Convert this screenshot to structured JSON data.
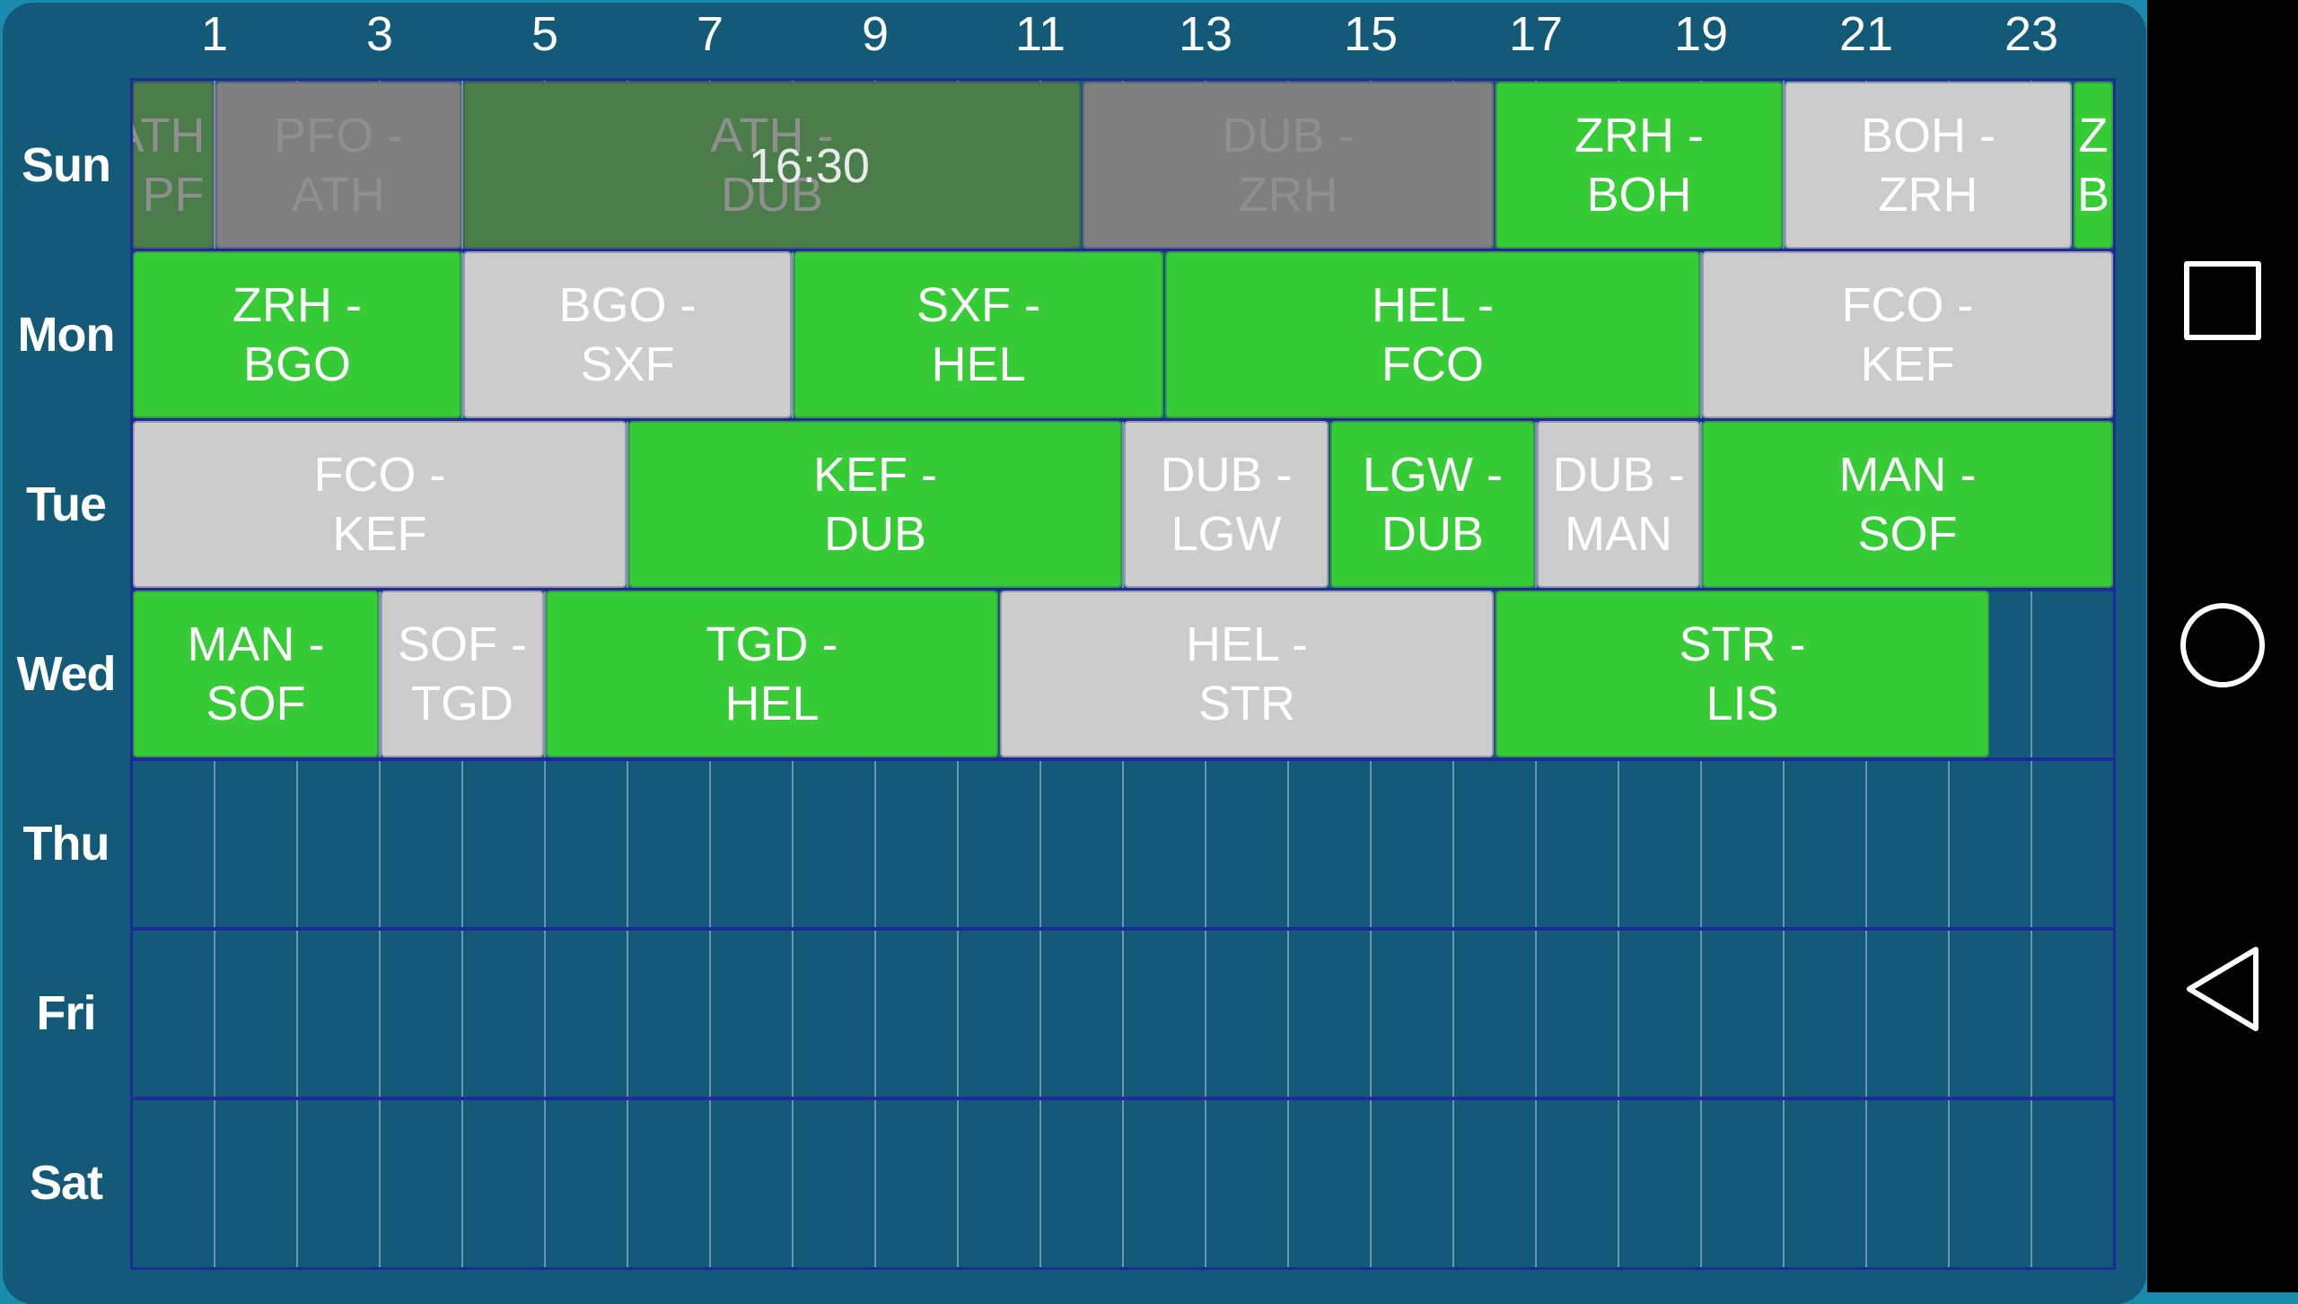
{
  "timetable": {
    "hour_labels": [
      "1",
      "3",
      "5",
      "7",
      "9",
      "11",
      "13",
      "15",
      "17",
      "19",
      "21",
      "23"
    ],
    "hour_label_values": [
      1,
      3,
      5,
      7,
      9,
      11,
      13,
      15,
      17,
      19,
      21,
      23
    ],
    "days": [
      "Sun",
      "Mon",
      "Tue",
      "Wed",
      "Thu",
      "Fri",
      "Sat"
    ],
    "current_time": "16:30",
    "current_time_position": {
      "day": 0,
      "hour": 8.2
    },
    "colors": {
      "active_green": "#36cc36",
      "active_gray": "#cccccc",
      "past_green": "#4a7d4a",
      "past_gray": "#7f7f7f",
      "grid_border": "#1f2a9a",
      "panel_background": "#135a78"
    },
    "flights": [
      {
        "day": 0,
        "start": 0,
        "end": 1,
        "from": "ATH",
        "to": "PFO",
        "line1": "ATH -",
        "line2": "PF",
        "color": "green",
        "past": true
      },
      {
        "day": 0,
        "start": 1,
        "end": 4,
        "from": "PFO",
        "to": "ATH",
        "line1": "PFO -",
        "line2": "ATH",
        "color": "gray",
        "past": true
      },
      {
        "day": 0,
        "start": 4,
        "end": 11.5,
        "from": "ATH",
        "to": "DUB",
        "line1": "ATH -",
        "line2": "DUB",
        "color": "green",
        "past": true
      },
      {
        "day": 0,
        "start": 11.5,
        "end": 16.5,
        "from": "DUB",
        "to": "ZRH",
        "line1": "DUB -",
        "line2": "ZRH",
        "color": "gray",
        "past": true
      },
      {
        "day": 0,
        "start": 16.5,
        "end": 20,
        "from": "ZRH",
        "to": "BOH",
        "line1": "ZRH -",
        "line2": "BOH",
        "color": "green",
        "past": false
      },
      {
        "day": 0,
        "start": 20,
        "end": 23.5,
        "from": "BOH",
        "to": "ZRH",
        "line1": "BOH -",
        "line2": "ZRH",
        "color": "gray",
        "past": false
      },
      {
        "day": 0,
        "start": 23.5,
        "end": 24,
        "from": "ZRH",
        "to": "BGO",
        "line1": "Z",
        "line2": "B",
        "color": "green",
        "past": false
      },
      {
        "day": 1,
        "start": 0,
        "end": 4,
        "from": "ZRH",
        "to": "BGO",
        "line1": "ZRH -",
        "line2": "BGO",
        "color": "green",
        "past": false
      },
      {
        "day": 1,
        "start": 4,
        "end": 8,
        "from": "BGO",
        "to": "SXF",
        "line1": "BGO -",
        "line2": "SXF",
        "color": "gray",
        "past": false
      },
      {
        "day": 1,
        "start": 8,
        "end": 12.5,
        "from": "SXF",
        "to": "HEL",
        "line1": "SXF -",
        "line2": "HEL",
        "color": "green",
        "past": false
      },
      {
        "day": 1,
        "start": 12.5,
        "end": 19,
        "from": "HEL",
        "to": "FCO",
        "line1": "HEL -",
        "line2": "FCO",
        "color": "green",
        "past": false
      },
      {
        "day": 1,
        "start": 19,
        "end": 24,
        "from": "FCO",
        "to": "KEF",
        "line1": "FCO -",
        "line2": "KEF",
        "color": "gray",
        "past": false
      },
      {
        "day": 2,
        "start": 0,
        "end": 6,
        "from": "FCO",
        "to": "KEF",
        "line1": "FCO -",
        "line2": "KEF",
        "color": "gray",
        "past": false
      },
      {
        "day": 2,
        "start": 6,
        "end": 12,
        "from": "KEF",
        "to": "DUB",
        "line1": "KEF -",
        "line2": "DUB",
        "color": "green",
        "past": false
      },
      {
        "day": 2,
        "start": 12,
        "end": 14.5,
        "from": "DUB",
        "to": "LGW",
        "line1": "DUB -",
        "line2": "LGW",
        "color": "gray",
        "past": false
      },
      {
        "day": 2,
        "start": 14.5,
        "end": 17,
        "from": "LGW",
        "to": "DUB",
        "line1": "LGW -",
        "line2": "DUB",
        "color": "green",
        "past": false
      },
      {
        "day": 2,
        "start": 17,
        "end": 19,
        "from": "DUB",
        "to": "MAN",
        "line1": "DUB -",
        "line2": "MAN",
        "color": "gray",
        "past": false
      },
      {
        "day": 2,
        "start": 19,
        "end": 24,
        "from": "MAN",
        "to": "SOF",
        "line1": "MAN -",
        "line2": "SOF",
        "color": "green",
        "past": false
      },
      {
        "day": 3,
        "start": 0,
        "end": 3,
        "from": "MAN",
        "to": "SOF",
        "line1": "MAN -",
        "line2": "SOF",
        "color": "green",
        "past": false
      },
      {
        "day": 3,
        "start": 3,
        "end": 5,
        "from": "SOF",
        "to": "TGD",
        "line1": "SOF -",
        "line2": "TGD",
        "color": "gray",
        "past": false
      },
      {
        "day": 3,
        "start": 5,
        "end": 10.5,
        "from": "TGD",
        "to": "HEL",
        "line1": "TGD -",
        "line2": "HEL",
        "color": "green",
        "past": false
      },
      {
        "day": 3,
        "start": 10.5,
        "end": 16.5,
        "from": "HEL",
        "to": "STR",
        "line1": "HEL -",
        "line2": "STR",
        "color": "gray",
        "past": false
      },
      {
        "day": 3,
        "start": 16.5,
        "end": 22.5,
        "from": "STR",
        "to": "LIS",
        "line1": "STR -",
        "line2": "LIS",
        "color": "green",
        "past": false
      }
    ]
  },
  "navbar": {
    "recents_icon": "square-outline",
    "home_icon": "circle-outline",
    "back_icon": "triangle-left-outline"
  }
}
